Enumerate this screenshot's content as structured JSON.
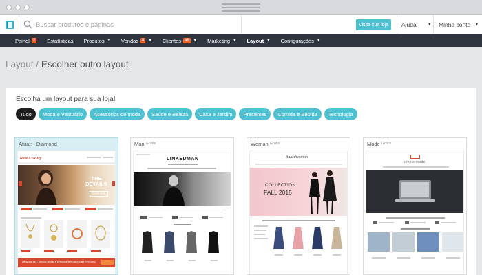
{
  "topbar": {
    "search_placeholder": "Buscar produtos e páginas",
    "visit_label": "Visite sua loja",
    "help_label": "Ajuda",
    "account_label": "Minha conta"
  },
  "nav": {
    "painel": "Painel",
    "painel_badge": "2",
    "estatisticas": "Estatísticas",
    "produtos": "Produtos",
    "vendas": "Vendas",
    "vendas_badge": "8",
    "clientes": "Clientes",
    "clientes_badge": "46",
    "marketing": "Marketing",
    "layout": "Layout",
    "configuracoes": "Configurações"
  },
  "breadcrumb": {
    "parent": "Layout",
    "separator": " / ",
    "current": "Escolher outro layout"
  },
  "panel": {
    "title": "Escolha um layout para sua loja!",
    "chips": [
      "Tudo",
      "Moda e Vestuário",
      "Acessórios de moda",
      "Saúde e Beleza",
      "Casa e Jardim",
      "Presentes",
      "Comida e Bebida",
      "Tecnologia"
    ]
  },
  "layouts": [
    {
      "title": "Atual: - Diamond",
      "current": true,
      "thumb": {
        "brand": "Real Luxury",
        "hero_title": "THE DETAILS",
        "hero_button": "SHOP NOW",
        "promo": "Deus sua vez - ultimos ofertas e perfumes tem valores ate 70% desc"
      }
    },
    {
      "title": "Man",
      "sub": "Grátis",
      "thumb": {
        "brand": "LINKEDMAN"
      }
    },
    {
      "title": "Woman",
      "sub": "Grátis",
      "thumb": {
        "brand": "linkedwoman",
        "hero_line1": "COLLECTION",
        "hero_line2": "FALL 2015"
      }
    },
    {
      "title": "Mode",
      "sub": "Grátis",
      "thumb": {
        "brand": "simple mode"
      }
    }
  ],
  "colors": {
    "accent": "#4fc0cf",
    "nav_bg": "#2f3640",
    "badge": "#f0632a",
    "page_bg": "#e4e6e8"
  }
}
